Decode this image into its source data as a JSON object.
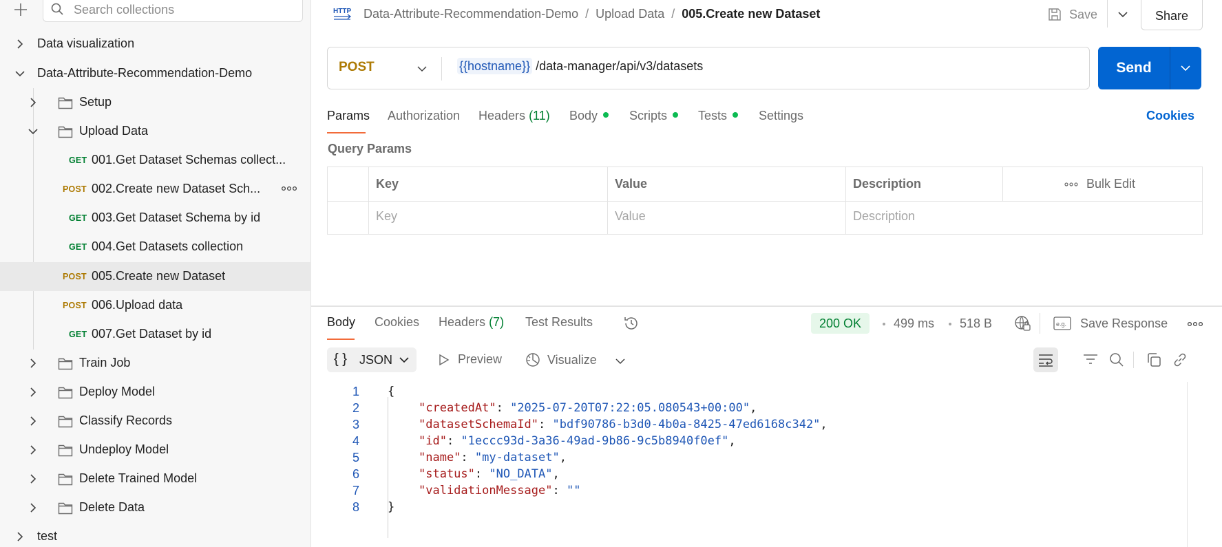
{
  "sidebar": {
    "search_placeholder": "Search collections",
    "tree": {
      "data_visualization": "Data visualization",
      "collection": "Data-Attribute-Recommendation-Demo",
      "setup": "Setup",
      "upload_data": "Upload Data",
      "requests": [
        {
          "method": "GET",
          "label": "001.Get Dataset Schemas collect..."
        },
        {
          "method": "POST",
          "label": "002.Create new Dataset Sch..."
        },
        {
          "method": "GET",
          "label": "003.Get Dataset Schema by id"
        },
        {
          "method": "GET",
          "label": "004.Get Datasets collection"
        },
        {
          "method": "POST",
          "label": "005.Create new Dataset"
        },
        {
          "method": "POST",
          "label": "006.Upload data"
        },
        {
          "method": "GET",
          "label": "007.Get Dataset by id"
        }
      ],
      "train_job": "Train Job",
      "deploy_model": "Deploy Model",
      "classify_records": "Classify Records",
      "undeploy_model": "Undeploy Model",
      "delete_trained_model": "Delete Trained Model",
      "delete_data": "Delete Data",
      "test": "test"
    }
  },
  "header": {
    "breadcrumb": [
      "Data-Attribute-Recommendation-Demo",
      "Upload Data",
      "005.Create new Dataset"
    ],
    "save_label": "Save",
    "share_label": "Share"
  },
  "request": {
    "method": "POST",
    "url_variable": "{{hostname}}",
    "url_path": " /data-manager/api/v3/datasets",
    "send_label": "Send"
  },
  "request_tabs": {
    "params": "Params",
    "authorization": "Authorization",
    "headers": "Headers",
    "headers_count": "(11)",
    "body": "Body",
    "scripts": "Scripts",
    "tests": "Tests",
    "settings": "Settings",
    "cookies": "Cookies"
  },
  "query_params": {
    "title": "Query Params",
    "columns": [
      "Key",
      "Value",
      "Description"
    ],
    "placeholders": [
      "Key",
      "Value",
      "Description"
    ],
    "bulk_edit": "Bulk Edit"
  },
  "response": {
    "tabs": {
      "body": "Body",
      "cookies": "Cookies",
      "headers": "Headers",
      "headers_count": "(7)",
      "test_results": "Test Results"
    },
    "status": "200 OK",
    "time": "499 ms",
    "size": "518 B",
    "save_response": "Save Response",
    "format": "JSON",
    "preview": "Preview",
    "visualize": "Visualize",
    "body_lines": [
      {
        "n": "1"
      },
      {
        "n": "2",
        "key": "\"createdAt\"",
        "value": "\"2025-07-20T07:22:05.080543+00:00\"",
        "end": ","
      },
      {
        "n": "3",
        "key": "\"datasetSchemaId\"",
        "value": "\"bdf90786-b3d0-4b0a-8425-47ed6168c342\"",
        "end": ","
      },
      {
        "n": "4",
        "key": "\"id\"",
        "value": "\"1eccc93d-3a36-49ad-9b86-9c5b8940f0ef\"",
        "end": ","
      },
      {
        "n": "5",
        "key": "\"name\"",
        "value": "\"my-dataset\"",
        "end": ","
      },
      {
        "n": "6",
        "key": "\"status\"",
        "value": "\"NO_DATA\"",
        "end": ","
      },
      {
        "n": "7",
        "key": "\"validationMessage\"",
        "value": "\"\"",
        "end": ""
      },
      {
        "n": "8"
      }
    ]
  },
  "colors": {
    "accent": "#0265d2",
    "get": "#007f31",
    "post": "#ad7a03",
    "tab_underline": "#f26b3a",
    "status_ok": "#007f31"
  }
}
